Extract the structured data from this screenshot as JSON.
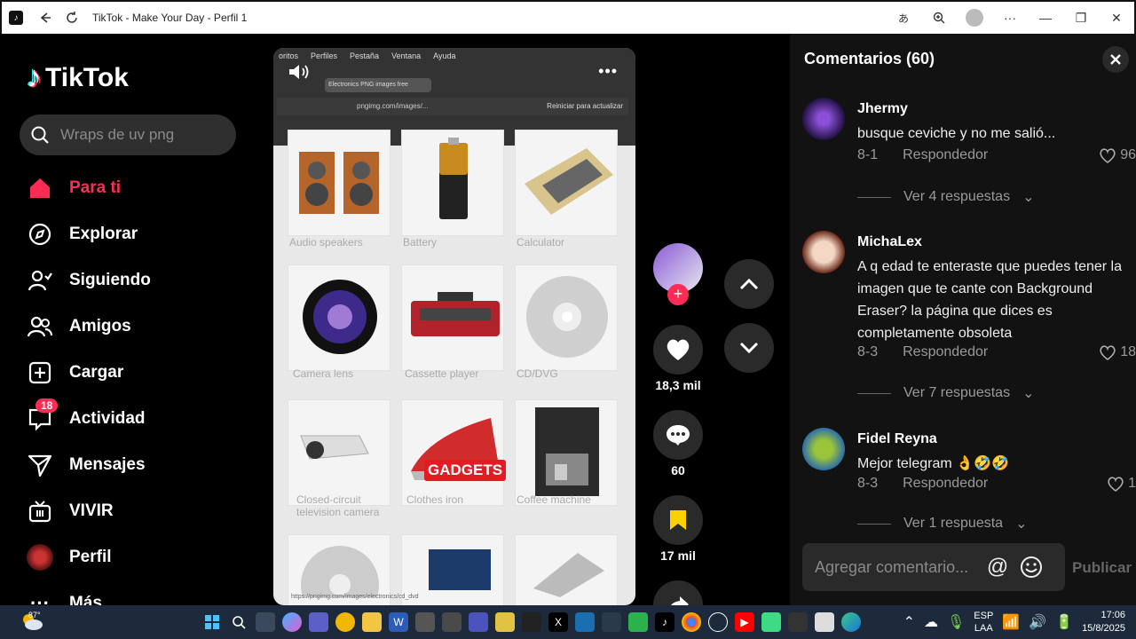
{
  "window": {
    "title": "TikTok - Make Your Day - Perfil 1"
  },
  "sidebar": {
    "logo": "TikTok",
    "search_placeholder": "Wraps de uv png",
    "items": [
      {
        "label": "Para ti",
        "icon": "home-icon",
        "active": true
      },
      {
        "label": "Explorar",
        "icon": "compass-icon"
      },
      {
        "label": "Siguiendo",
        "icon": "following-icon"
      },
      {
        "label": "Amigos",
        "icon": "friends-icon"
      },
      {
        "label": "Cargar",
        "icon": "upload-icon"
      },
      {
        "label": "Actividad",
        "icon": "activity-icon",
        "badge": "18"
      },
      {
        "label": "Mensajes",
        "icon": "send-icon"
      },
      {
        "label": "VIVIR",
        "icon": "live-icon"
      },
      {
        "label": "Perfil",
        "icon": "profile-avatar"
      },
      {
        "label": "Más",
        "icon": "more-icon"
      }
    ]
  },
  "video": {
    "browser_menu": [
      "oritos",
      "Perfiles",
      "Pestaña",
      "Ventana",
      "Ayuda"
    ],
    "tab_title": "Electronics PNG images free",
    "url": "pngimg.com/images/...",
    "reset_label": "Reiniciar para actualizar",
    "bottom_url": "https://pngimg.com/images/electronics/cd_dvd",
    "gadgets_label": "GADGETS",
    "products": [
      "Audio speakers",
      "Battery",
      "Calculator",
      "Camera lens",
      "Cassette player",
      "CD/DVG",
      "Closed-circuit television camera",
      "Clothes iron",
      "Coffee machine"
    ]
  },
  "actions": {
    "likes": "18,3 mil",
    "comments": "60",
    "saves": "17 mil"
  },
  "comments_panel": {
    "title": "Comentarios (60)",
    "input_placeholder": "Agregar comentario...",
    "publish_label": "Publicar",
    "comments": [
      {
        "user": "Jhermy",
        "text": "busque ceviche y no me salió...",
        "date": "8-1",
        "reply": "Respondedor",
        "likes": "96",
        "replies": "Ver 4 respuestas"
      },
      {
        "user": "MichaLex",
        "text": "A q edad te enteraste que puedes tener la imagen que te cante con Background Eraser? la página que dices es completamente obsoleta",
        "date": "8-3",
        "reply": "Respondedor",
        "likes": "18",
        "replies": "Ver 7 respuestas"
      },
      {
        "user": "Fidel Reyna",
        "text": "Mejor telegram 👌🤣🤣",
        "date": "8-3",
        "reply": "Respondedor",
        "likes": "1",
        "replies": "Ver 1 respuesta"
      }
    ]
  },
  "taskbar": {
    "temp": "87°",
    "lang_top": "ESP",
    "lang_bottom": "LAA",
    "time": "17:06",
    "date": "15/8/2025"
  }
}
